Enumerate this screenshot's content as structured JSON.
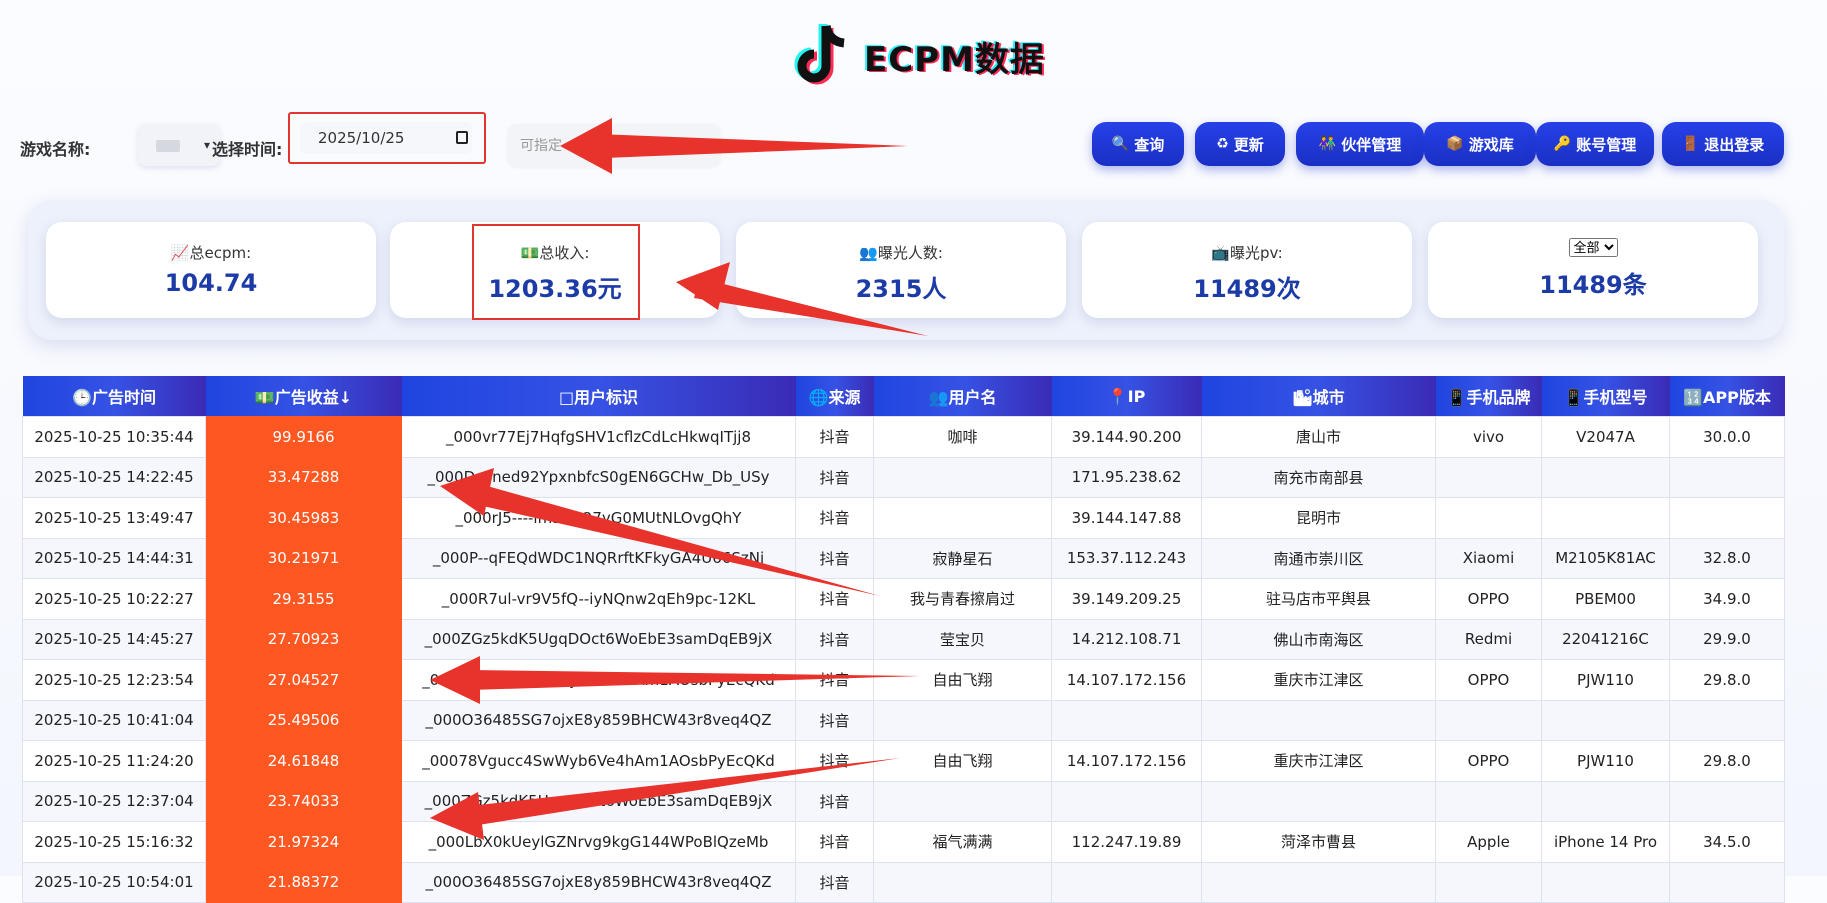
{
  "header": {
    "title": "ECPM数据"
  },
  "filter": {
    "game_label": "游戏名称:",
    "time_label": "选择时间:",
    "date_value": "2025/10/25",
    "specify_placeholder": "可指定"
  },
  "buttons": [
    {
      "icon": "🔍",
      "label": "查询"
    },
    {
      "icon": "♻",
      "label": "更新"
    },
    {
      "icon": "👫",
      "label": "伙伴管理"
    },
    {
      "icon": "📦",
      "label": "游戏库"
    },
    {
      "icon": "🔑",
      "label": "账号管理"
    },
    {
      "icon": "🚪",
      "label": "退出登录"
    }
  ],
  "stats": [
    {
      "icon": "📈",
      "label": "总ecpm:",
      "value": "104.74"
    },
    {
      "icon": "💵",
      "label": "总收入:",
      "value": "1203.36元"
    },
    {
      "icon": "👥",
      "label": "曝光人数:",
      "value": "2315人"
    },
    {
      "icon": "📺",
      "label": "曝光pv:",
      "value": "11489次"
    },
    {
      "select": "全部",
      "value": "11489条"
    }
  ],
  "table": {
    "headers": [
      "🕒广告时间",
      "💵广告收益↓",
      "□用户标识",
      "🌐来源",
      "👥用户名",
      "📍IP",
      "🏙城市",
      "📱手机品牌",
      "📱手机型号",
      "🔢APP版本"
    ],
    "rows": [
      [
        "2025-10-25 10:35:44",
        "99.9166",
        "_000vr77Ej7HqfgSHV1cflzCdLcHkwqITjj8",
        "抖音",
        "咖啡",
        "39.144.90.200",
        "唐山市",
        "vivo",
        "V2047A",
        "30.0.0"
      ],
      [
        "2025-10-25 14:22:45",
        "33.47288",
        "_000D_9ned92YpxnbfcS0gEN6GCHw_Db_USy",
        "抖音",
        "",
        "171.95.238.62",
        "南充市南部县",
        "",
        "",
        ""
      ],
      [
        "2025-10-25 13:49:47",
        "30.45983",
        "_000rJ5----lmD5n27yG0MUtNLOvgQhY",
        "抖音",
        "",
        "39.144.147.88",
        "昆明市",
        "",
        "",
        ""
      ],
      [
        "2025-10-25 14:44:31",
        "30.21971",
        "_000P--qFEQdWDC1NQRrftKFkyGA4U66SzNj",
        "抖音",
        "寂静星石",
        "153.37.112.243",
        "南通市崇川区",
        "Xiaomi",
        "M2105K81AC",
        "32.8.0"
      ],
      [
        "2025-10-25 10:22:27",
        "29.3155",
        "_000R7ul-vr9V5fQ--iyNQnw2qEh9pc-12KL",
        "抖音",
        "我与青春擦肩过",
        "39.149.209.25",
        "驻马店市平舆县",
        "OPPO",
        "PBEM00",
        "34.9.0"
      ],
      [
        "2025-10-25 14:45:27",
        "27.70923",
        "_000ZGz5kdK5UgqDOct6WoEbE3samDqEB9jX",
        "抖音",
        "莹宝贝",
        "14.212.108.71",
        "佛山市南海区",
        "Redmi",
        "22041216C",
        "29.9.0"
      ],
      [
        "2025-10-25 12:23:54",
        "27.04527",
        "_00078Vgucc4SwWyb6Ve4hAm1AOsbPyEcQKd",
        "抖音",
        "自由飞翔",
        "14.107.172.156",
        "重庆市江津区",
        "OPPO",
        "PJW110",
        "29.8.0"
      ],
      [
        "2025-10-25 10:41:04",
        "25.49506",
        "_000O36485SG7ojxE8y859BHCW43r8veq4QZ",
        "抖音",
        "",
        "",
        "",
        "",
        "",
        ""
      ],
      [
        "2025-10-25 11:24:20",
        "24.61848",
        "_00078Vgucc4SwWyb6Ve4hAm1AOsbPyEcQKd",
        "抖音",
        "自由飞翔",
        "14.107.172.156",
        "重庆市江津区",
        "OPPO",
        "PJW110",
        "29.8.0"
      ],
      [
        "2025-10-25 12:37:04",
        "23.74033",
        "_000ZGz5kdK5UgqDOct6WoEbE3samDqEB9jX",
        "抖音",
        "",
        "",
        "",
        "",
        "",
        ""
      ],
      [
        "2025-10-25 15:16:32",
        "21.97324",
        "_000LbX0kUeylGZNrvg9kgG144WPoBlQzeMb",
        "抖音",
        "福气满满",
        "112.247.19.89",
        "菏泽市曹县",
        "Apple",
        "iPhone 14 Pro",
        "34.5.0"
      ],
      [
        "2025-10-25 10:54:01",
        "21.88372",
        "_000O36485SG7ojxE8y859BHCW43r8veq4QZ",
        "抖音",
        "",
        "",
        "",
        "",
        "",
        ""
      ]
    ]
  }
}
